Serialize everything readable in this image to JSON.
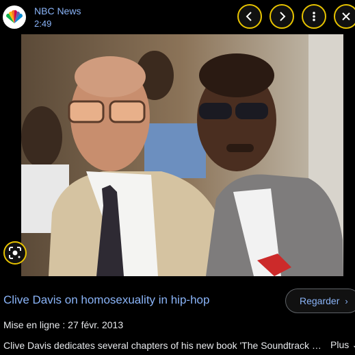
{
  "source": {
    "name": "NBC News",
    "duration": "2:49",
    "icon": "nbc-peacock-logo"
  },
  "controls": {
    "prev_icon": "chevron-left-icon",
    "next_icon": "chevron-right-icon",
    "menu_icon": "more-vert-icon",
    "close_icon": "close-icon"
  },
  "lens_icon": "google-lens-icon",
  "video": {
    "title": "Clive Davis on homosexuality in hip-hop",
    "watch_label": "Regarder",
    "upload_date": "Mise en ligne : 27 févr. 2013",
    "description": "Clive Davis dedicates several chapters of his new book 'The Soundtrack of My Life' to his personal life",
    "more_label": "Plus"
  }
}
